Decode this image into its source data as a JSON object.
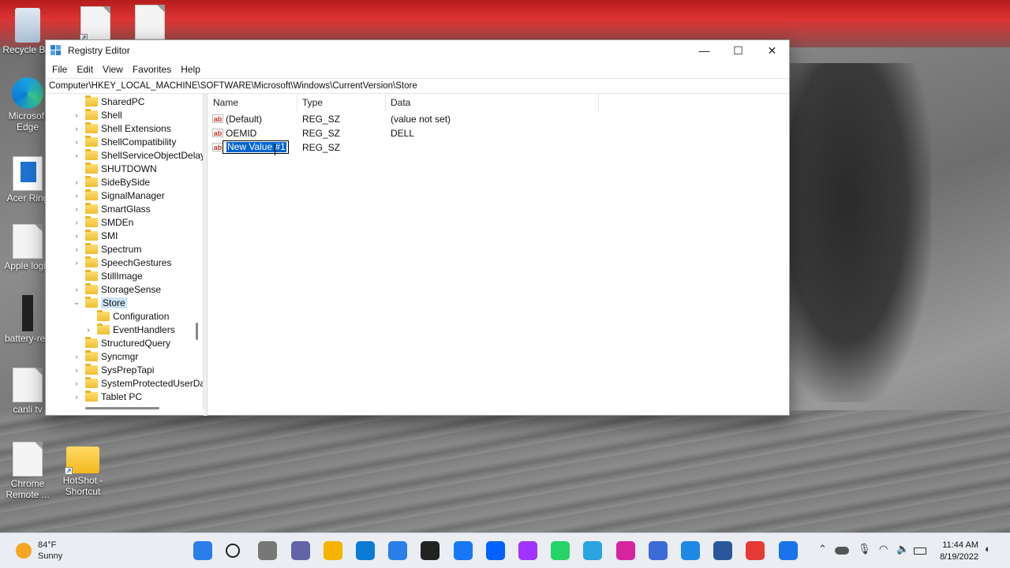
{
  "window": {
    "title": "Registry Editor",
    "controls": {
      "minimize": "—",
      "maximize": "☐",
      "close": "✕"
    },
    "menu": [
      "File",
      "Edit",
      "View",
      "Favorites",
      "Help"
    ],
    "address": "Computer\\HKEY_LOCAL_MACHINE\\SOFTWARE\\Microsoft\\Windows\\CurrentVersion\\Store"
  },
  "tree": {
    "items": [
      {
        "label": "SharedPC",
        "expander": ""
      },
      {
        "label": "Shell",
        "expander": ">"
      },
      {
        "label": "Shell Extensions",
        "expander": ">"
      },
      {
        "label": "ShellCompatibility",
        "expander": ">"
      },
      {
        "label": "ShellServiceObjectDelay",
        "expander": ">"
      },
      {
        "label": "SHUTDOWN",
        "expander": ""
      },
      {
        "label": "SideBySide",
        "expander": ">"
      },
      {
        "label": "SignalManager",
        "expander": ">"
      },
      {
        "label": "SmartGlass",
        "expander": ">"
      },
      {
        "label": "SMDEn",
        "expander": ">"
      },
      {
        "label": "SMI",
        "expander": ">"
      },
      {
        "label": "Spectrum",
        "expander": ">"
      },
      {
        "label": "SpeechGestures",
        "expander": ">"
      },
      {
        "label": "StillImage",
        "expander": ""
      },
      {
        "label": "StorageSense",
        "expander": ">"
      },
      {
        "label": "Store",
        "expander": "v",
        "selected": true
      },
      {
        "label": "Configuration",
        "expander": "",
        "child": true
      },
      {
        "label": "EventHandlers",
        "expander": ">",
        "child": true
      },
      {
        "label": "StructuredQuery",
        "expander": ""
      },
      {
        "label": "Syncmgr",
        "expander": ">"
      },
      {
        "label": "SysPrepTapi",
        "expander": ">"
      },
      {
        "label": "SystemProtectedUserDa",
        "expander": ">"
      },
      {
        "label": "Tablet PC",
        "expander": ">"
      }
    ]
  },
  "list": {
    "columns": [
      "Name",
      "Type",
      "Data"
    ],
    "rows": [
      {
        "icon": "ab",
        "name": "(Default)",
        "type": "REG_SZ",
        "data": "(value not set)"
      },
      {
        "icon": "ab",
        "name": "OEMID",
        "type": "REG_SZ",
        "data": "DELL"
      },
      {
        "icon": "ab",
        "name": "New Value #1",
        "type": "REG_SZ",
        "data": "",
        "editing": true
      }
    ]
  },
  "desktop_icons": [
    {
      "label": "Recycle Bin",
      "icon": "recycle-bin-icon"
    },
    {
      "label": "Microsoft Edge",
      "icon": "edge-icon"
    },
    {
      "label": "Acer Ring",
      "icon": "acer-ring-icon"
    },
    {
      "label": "Apple login",
      "icon": "document-icon"
    },
    {
      "label": "battery-rep",
      "icon": "battery-icon"
    },
    {
      "label": "canli tv",
      "icon": "document-icon"
    },
    {
      "label": "Chrome Remote ...",
      "icon": "document-icon"
    },
    {
      "label": "HotShot - Shortcut",
      "icon": "folder-icon"
    }
  ],
  "taskbar": {
    "weather": {
      "temp": "84°F",
      "condition": "Sunny"
    },
    "time": "11:44 AM",
    "date": "8/19/2022",
    "pinned": [
      "start-icon",
      "search-icon",
      "task-view-icon",
      "chat-icon",
      "file-explorer-icon",
      "edge-icon",
      "store-icon",
      "app-icon",
      "facebook-icon",
      "dropbox-icon",
      "messenger-icon",
      "whatsapp-icon",
      "telegram-icon",
      "instagram-icon",
      "photos-icon",
      "cortana-icon",
      "word-icon",
      "camera-icon",
      "registry-editor-icon"
    ],
    "tray": [
      "chevron-up-icon",
      "cloud-icon",
      "microphone-icon",
      "wifi-icon",
      "volume-icon",
      "battery-icon"
    ]
  },
  "colors": {
    "selection": "#0064d2",
    "tree_selected": "#cce4f7",
    "taskbar": "#eaedf1"
  }
}
